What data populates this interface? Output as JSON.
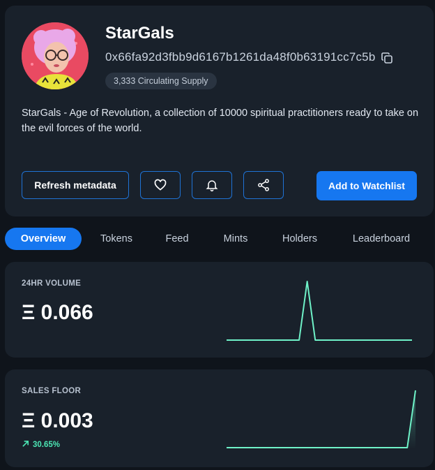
{
  "collection": {
    "name": "StarGals",
    "address": "0x66fa92d3fbb9d6167b1261da48f0b63191cc7c5b",
    "supply": "3,333 Circulating Supply",
    "description": "StarGals - Age of Revolution, a collection of 10000 spiritual practitioners ready to take on the evil forces of the world."
  },
  "actions": {
    "refresh_label": "Refresh metadata",
    "watchlist_label": "Add to Watchlist",
    "icons": [
      "heart-icon",
      "bell-icon",
      "share-icon"
    ]
  },
  "tabs": [
    {
      "label": "Overview",
      "active": true
    },
    {
      "label": "Tokens",
      "active": false
    },
    {
      "label": "Feed",
      "active": false
    },
    {
      "label": "Mints",
      "active": false
    },
    {
      "label": "Holders",
      "active": false
    },
    {
      "label": "Leaderboard",
      "active": false
    }
  ],
  "stats": {
    "volume": {
      "label": "24HR VOLUME",
      "value": "Ξ 0.066",
      "sparkline": [
        0,
        0,
        0,
        0,
        0,
        0,
        0,
        0,
        0,
        0,
        1,
        0,
        0,
        0,
        0,
        0,
        0,
        0,
        0,
        0,
        0,
        0,
        0,
        0
      ]
    },
    "floor": {
      "label": "SALES FLOOR",
      "value": "Ξ 0.003",
      "change": "30.65%",
      "sparkline": [
        0,
        0,
        0,
        0,
        0,
        0,
        0,
        0,
        0,
        0,
        0,
        0,
        0,
        0,
        0,
        0,
        0,
        0,
        0,
        0,
        0,
        0,
        0,
        1
      ]
    }
  },
  "colors": {
    "accent": "#1677f0",
    "spark": "#6ff2c8",
    "positive": "#4ce6b4"
  }
}
